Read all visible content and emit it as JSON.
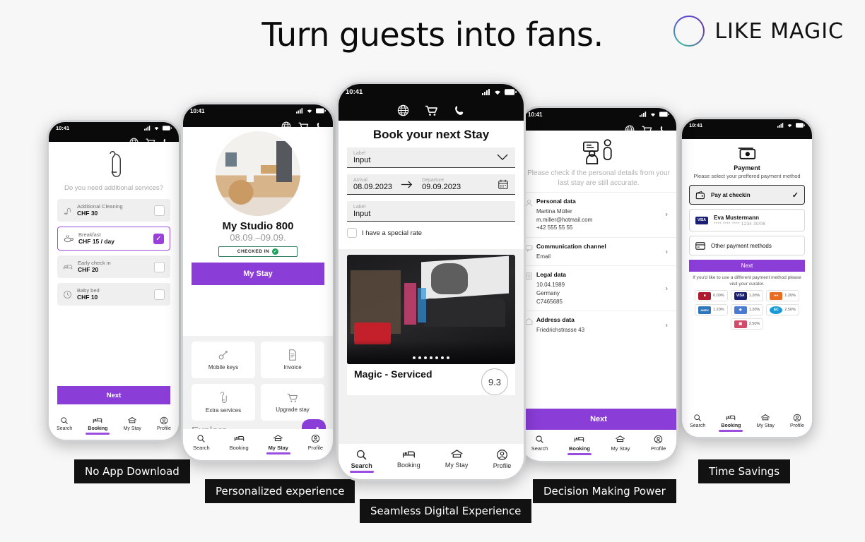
{
  "page": {
    "headline": "Turn guests into fans.",
    "brand_name": "LIKE MAGIC",
    "background_color": "#F7F7F7",
    "accent_purple": "#8B3DD8"
  },
  "captions": [
    {
      "label": "No App Download"
    },
    {
      "label": "Personalized experience"
    },
    {
      "label": "Seamless Digital Experience"
    },
    {
      "label": "Decision Making Power"
    },
    {
      "label": "Time Savings"
    }
  ],
  "tabbar": {
    "search": "Search",
    "booking": "Booking",
    "my_stay": "My Stay",
    "profile": "Profile"
  },
  "phone1": {
    "status_time": "10:41",
    "question": "Do you need additional services?",
    "services": [
      {
        "name": "Additional Cleaning",
        "price": "CHF 30",
        "checked": false,
        "icon": "vacuum-icon"
      },
      {
        "name": "Breakfast",
        "price": "CHF 15 / day",
        "checked": true,
        "icon": "breakfast-icon"
      },
      {
        "name": "Early check in",
        "price": "CHF 20",
        "checked": false,
        "icon": "bed-icon"
      },
      {
        "name": "Baby bed",
        "price": "CHF 10",
        "checked": false,
        "icon": "clock-icon"
      }
    ],
    "next_label": "Next",
    "active_tab": "Booking"
  },
  "phone2": {
    "status_time": "10:41",
    "stay_title": "My Studio 800",
    "stay_dates": "08.09.–09.09.",
    "status_chip": "CHECKED IN",
    "primary_button": "My Stay",
    "tiles": [
      {
        "label": "Mobile keys",
        "icon": "key-icon"
      },
      {
        "label": "Invoice",
        "icon": "document-icon"
      },
      {
        "label": "Extra services",
        "icon": "door-hanger-icon"
      },
      {
        "label": "Upgrade stay",
        "icon": "cart-icon"
      }
    ],
    "explore_label": "Explore",
    "active_tab": "My Stay"
  },
  "phone3": {
    "status_time": "10:41",
    "title": "Book your next Stay",
    "fields": [
      {
        "label": "Label",
        "value": "Input",
        "control": "chevron-down-icon"
      },
      {
        "label_from": "Arrival",
        "value_from": "08.09.2023",
        "label_to": "Departure",
        "value_to": "09.09.2023",
        "control": "calendar-icon"
      },
      {
        "label": "Label",
        "value": "Input",
        "control": "none"
      }
    ],
    "checkbox_label": "I have a special rate",
    "checkbox_checked": false,
    "carousel_dots": 7,
    "carousel_active_dot": 1,
    "result_title": "Magic - Serviced",
    "result_score": "9.3",
    "active_tab": "Search"
  },
  "phone4": {
    "status_time": "10:41",
    "intro": "Please check if the personal details from your last stay are still accurate.",
    "sections": [
      {
        "heading": "Personal data",
        "lines": [
          "Martina Müller",
          "m.miller@hotmail.com",
          "+42 555 55 55"
        ],
        "icon": "person-icon"
      },
      {
        "heading": "Communication channel",
        "lines": [
          "Email"
        ],
        "icon": "chat-icon"
      },
      {
        "heading": "Legal data",
        "lines": [
          "10.04.1989",
          "Germany",
          "C7465685"
        ],
        "icon": "passport-icon"
      },
      {
        "heading": "Address data",
        "lines": [
          "Friedrichstrasse 43"
        ],
        "icon": "home-icon"
      }
    ],
    "next_label": "Next",
    "active_tab": "Booking"
  },
  "phone5": {
    "status_time": "10:41",
    "title": "Payment",
    "subtitle": "Please select your preffered payment method",
    "methods": [
      {
        "label": "Pay at checkin",
        "selected": true,
        "icon": "wallet-icon"
      },
      {
        "label": "Eva Mustermann",
        "sub": "**** **** **** 1234 30/06",
        "selected": false,
        "icon": "visa-logo"
      },
      {
        "label": "Other payment methods",
        "selected": false,
        "icon": "card-icon"
      }
    ],
    "next_label": "Next",
    "note": "If you'd like to use a different payment method please visit your curator.",
    "fees": [
      {
        "brand": "JCB",
        "rate": "0.00%",
        "color": "#b01a2e"
      },
      {
        "brand": "VISA",
        "rate": "1.20%",
        "color": "#1a1f71"
      },
      {
        "brand": "MC",
        "rate": "1.20%",
        "color": "#eb6b1f"
      },
      {
        "brand": "AMEX",
        "rate": "1.20%",
        "color": "#2e77bc"
      },
      {
        "brand": "DIN",
        "rate": "1.20%",
        "color": "#4a7bd0"
      },
      {
        "brand": "EC",
        "rate": "2.50%",
        "color": "#1a9ad7"
      },
      {
        "brand": "JCB2",
        "rate": "2.50%",
        "color": "#d44a6b"
      }
    ],
    "active_tab": "Booking"
  }
}
